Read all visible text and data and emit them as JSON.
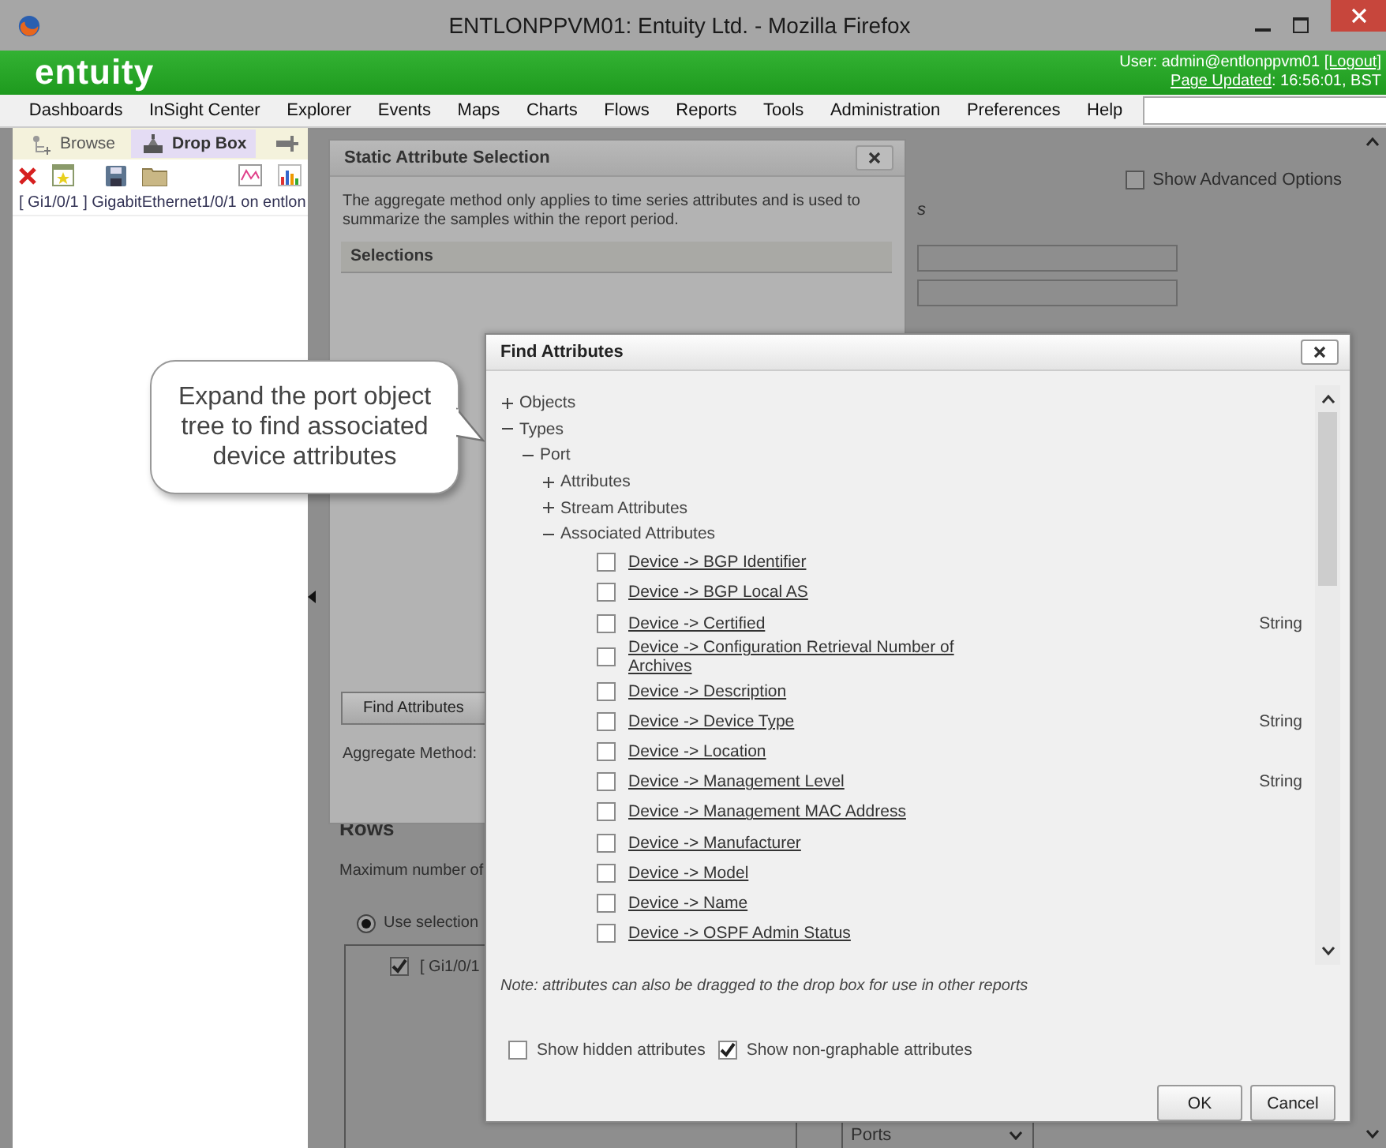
{
  "window": {
    "title": "ENTLONPPVM01: Entuity Ltd. - Mozilla Firefox"
  },
  "header": {
    "logo": "entuity",
    "user_label": "User: admin@entlonppvm01",
    "logout": "[Logout]",
    "page_updated_link": "Page Updated",
    "page_updated_time": ": 16:56:01, BST"
  },
  "menu": [
    "Dashboards",
    "InSight Center",
    "Explorer",
    "Events",
    "Maps",
    "Charts",
    "Flows",
    "Reports",
    "Tools",
    "Administration",
    "Preferences",
    "Help"
  ],
  "left_panel": {
    "tabs": [
      {
        "label": "Browse",
        "selected": false
      },
      {
        "label": "Drop Box",
        "selected": true
      }
    ],
    "items": [
      "[ Gi1/0/1 ] GigabitEthernet1/0/1 on entlon"
    ]
  },
  "page": {
    "show_advanced": {
      "label": "Show Advanced Options",
      "checked": false
    },
    "fragment": "s",
    "rows_heading": "Rows",
    "max_rows_label": "Maximum number of",
    "use_selection": {
      "label": "Use selection",
      "selected": true
    },
    "selection_item": {
      "label": "[ Gi1/0/1",
      "checked": true
    },
    "dropdown_value": "Ports"
  },
  "static_dialog": {
    "title": "Static Attribute Selection",
    "description": "The aggregate method only applies to time series attributes and is used to summarize the samples within the report period.",
    "section": "Selections",
    "find_button": "Find Attributes",
    "aggregate_label": "Aggregate Method:"
  },
  "find_dialog": {
    "title": "Find Attributes",
    "tree": [
      {
        "label": "Objects",
        "expanded": false
      },
      {
        "label": "Types",
        "expanded": true,
        "children": [
          {
            "label": "Port",
            "expanded": true,
            "children": [
              {
                "label": "Attributes",
                "expanded": false
              },
              {
                "label": "Stream Attributes",
                "expanded": false
              },
              {
                "label": "Associated Attributes",
                "expanded": true,
                "attributes": [
                  {
                    "name": "Device -> BGP Identifier",
                    "checked": false
                  },
                  {
                    "name": "Device -> BGP Local AS",
                    "checked": false
                  },
                  {
                    "name": "Device -> Certified",
                    "type": "String",
                    "checked": false
                  },
                  {
                    "name": "Device -> Configuration Retrieval Number of Archives",
                    "checked": false
                  },
                  {
                    "name": "Device -> Description",
                    "checked": false
                  },
                  {
                    "name": "Device -> Device Type",
                    "type": "String",
                    "checked": false
                  },
                  {
                    "name": "Device -> Location",
                    "checked": false
                  },
                  {
                    "name": "Device -> Management Level",
                    "type": "String",
                    "checked": false
                  },
                  {
                    "name": "Device -> Management MAC Address",
                    "checked": false
                  },
                  {
                    "name": "Device -> Manufacturer",
                    "checked": false
                  },
                  {
                    "name": "Device -> Model",
                    "checked": false
                  },
                  {
                    "name": "Device -> Name",
                    "checked": false
                  },
                  {
                    "name": "Device -> OSPF Admin Status",
                    "checked": false
                  }
                ]
              }
            ]
          }
        ]
      }
    ],
    "note": "Note: attributes can also be dragged to the drop box for use in other reports",
    "options": [
      {
        "label": "Show hidden attributes",
        "checked": false
      },
      {
        "label": "Show non-graphable attributes",
        "checked": true
      }
    ],
    "buttons": [
      "OK",
      "Cancel"
    ]
  },
  "callout": {
    "text": "Expand the port object tree to find associated device attributes"
  }
}
